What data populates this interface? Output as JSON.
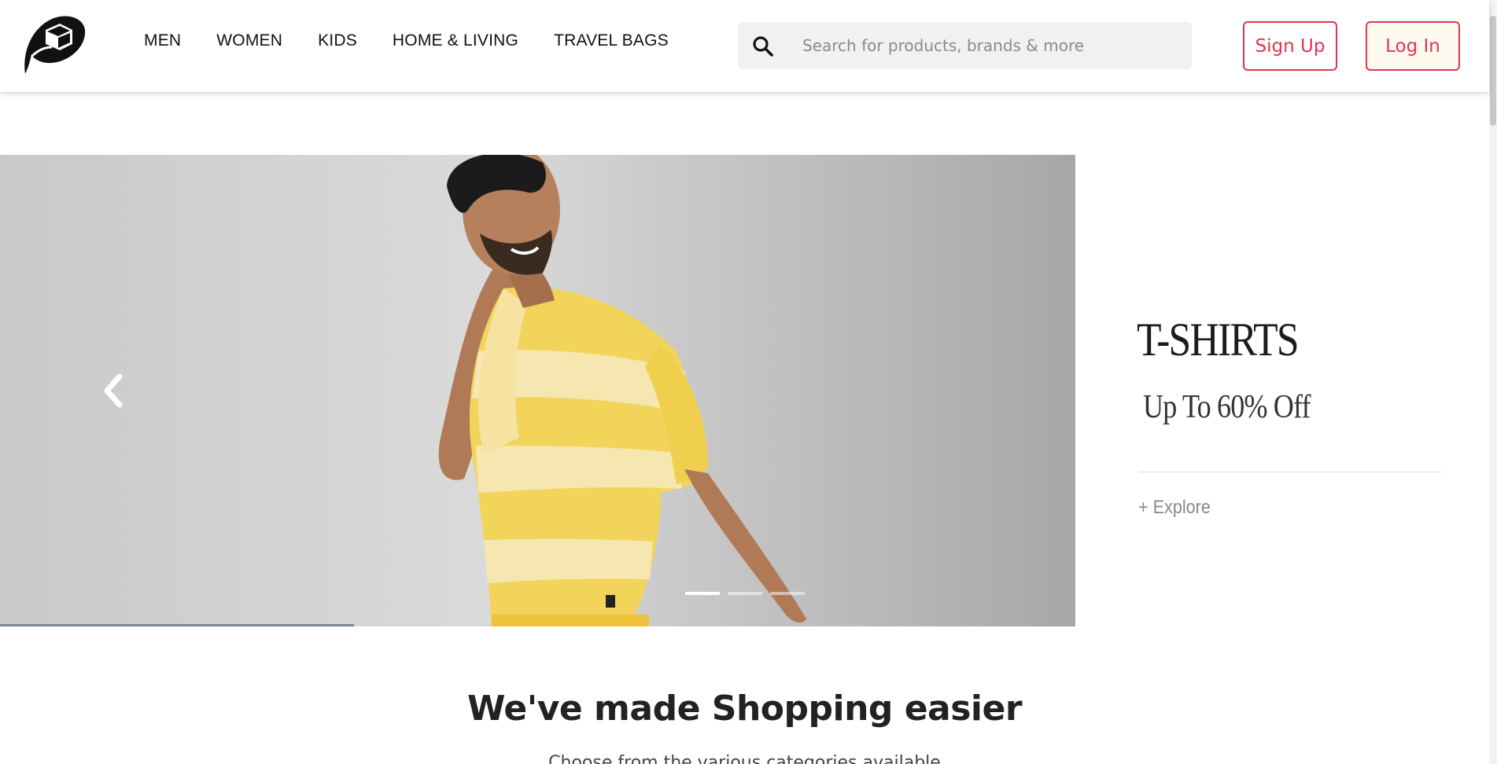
{
  "header": {
    "logo_icon": "leaf-cube-logo",
    "nav": [
      {
        "label": "MEN"
      },
      {
        "label": "WOMEN"
      },
      {
        "label": "KIDS"
      },
      {
        "label": "HOME & LIVING"
      },
      {
        "label": "TRAVEL BAGS"
      }
    ],
    "search": {
      "icon": "search-icon",
      "placeholder": "Search for products, brands & more",
      "value": ""
    },
    "signup_label": "Sign Up",
    "login_label": "Log In"
  },
  "carousel": {
    "prev_icon": "chevron-left-icon",
    "slide_count": 3,
    "active_slide": 1,
    "promo": {
      "title": "T-SHIRTS",
      "subtitle": "Up To 60% Off",
      "cta": "+ Explore"
    }
  },
  "section": {
    "title": "We've made Shopping easier",
    "subtitle": "Choose from the various categories available"
  },
  "colors": {
    "accent": "#e0364f",
    "login_bg": "#fffaf0",
    "search_bg": "#f1f1f2"
  }
}
